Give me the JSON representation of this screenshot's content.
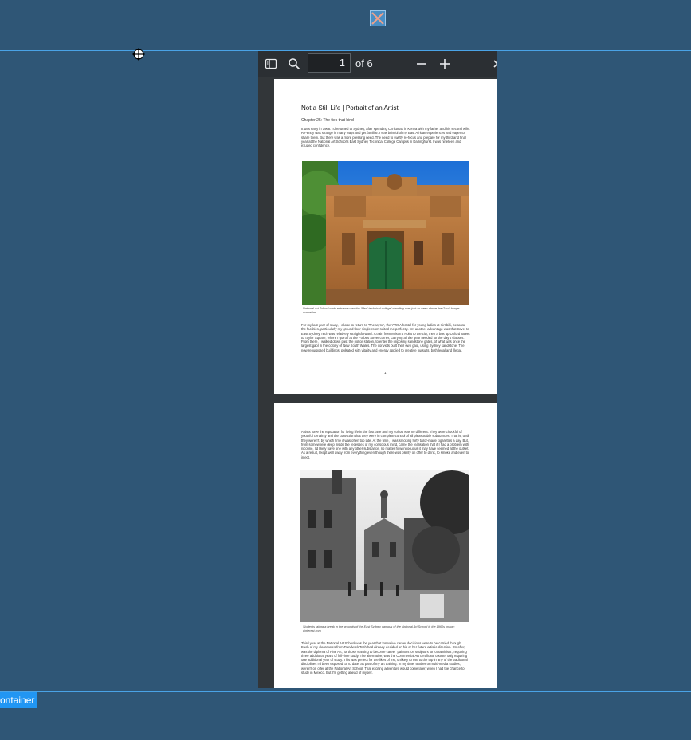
{
  "overlay": {
    "container_label": "ontainer"
  },
  "viewer": {
    "current_page": "1",
    "page_count_label": "of 6",
    "icons": [
      "sidebar-toggle-icon",
      "search-icon",
      "zoom-out-icon",
      "zoom-in-icon"
    ]
  },
  "document": {
    "title": "Not a Still Life | Portrait of an Artist",
    "chapter": "Chapter 25: The ties that bind",
    "page1": {
      "para1": "It was early in 1968. I'd returned to Sydney, after spending Christmas in Kenya with my father and his second wife. Re-entry was strange in many ways and yet familiar. I was brimful of my East African experiences and eager to share them. But there was a more pressing need. The need to swiftly re-focus and prepare for my third and final year at the National Art School's East Sydney Technical College Campus in Darlinghurst. I was nineteen and exuded confidence.",
      "caption": "National Art School main entrance was the 'Men' technical college' standing over just as seen above the Gaol.\nImage: ourwalline",
      "para2": "For my last year of study, I chose to return to 'Thenayne', the YWCA hostel for young ladies at Kirribilli, because the facilities, particularly my ground floor single room suited me perfectly. Yet another advantage was that travel to East Sydney Tech was relatively straightforward. A train from Milson's Point to the city, then a bus up Oxford Street to Taylor Square, where I got off at the Forbes Street corner, carrying all the gear needed for the day's classes. From there, I walked down past the police station, to enter the imposing sandstone gates, of what was once the largest gaol in the colony of New South Wales. The convicts built their own gaol, using Sydney sandstone. The now repurposed buildings, pulsated with vitality and energy applied to creative pursuits, both legal and illegal.",
      "page_number": "1"
    },
    "page2": {
      "para1": "Artists have the reputation for living life in the fast lane and my cohort was no different. They were chockful of youthful certainty and the conviction that they were in complete control of all pleasurable substances. That is, until they weren't, by which time it was often too late. At the time, I was smoking forty tailor-made cigarettes a day. But, from somewhere deep inside the recesses of my conscious mind, came the realisation that if I had a problem with nicotine, I'd likely have one with any other substance, no matter how innocuous it may have seemed at the outset. As a result, I kept well away from everything even though there was plenty on offer to drink, to smoke and even to inject.",
      "caption": "Students taking a break in the grounds of the East Sydney campus of the National Art School in the 1960s\nImage: pinterest.com",
      "para2": "Third year at the National Art School was the year that formative career decisions were to be carried through. Each of my classmates from Randwick Tech had already decided on his or her future artistic direction. On offer, was the diploma of Fine Art, for those wanting to become career 'painters' or 'sculptors' or 'ceramicists', requiring three additional years of full-time study. The alternative, was the Commercial Art certificate course, only requiring one additional year of study. This was perfect for the likes of me, unlikely to rise to the top in any of the traditional disciplines I'd been exposed to, to date, as part of my art training. In my time, textiles or multi-media studies, weren't on offer at the National Art School. That exciting adventure would come later, when I had the chance to study in Mexico. But I'm getting ahead of myself."
    }
  },
  "colors": {
    "background": "#2f5676",
    "accent": "#2196f3",
    "viewer_bg": "#323639",
    "toolbar_bg": "#2b2f33"
  }
}
